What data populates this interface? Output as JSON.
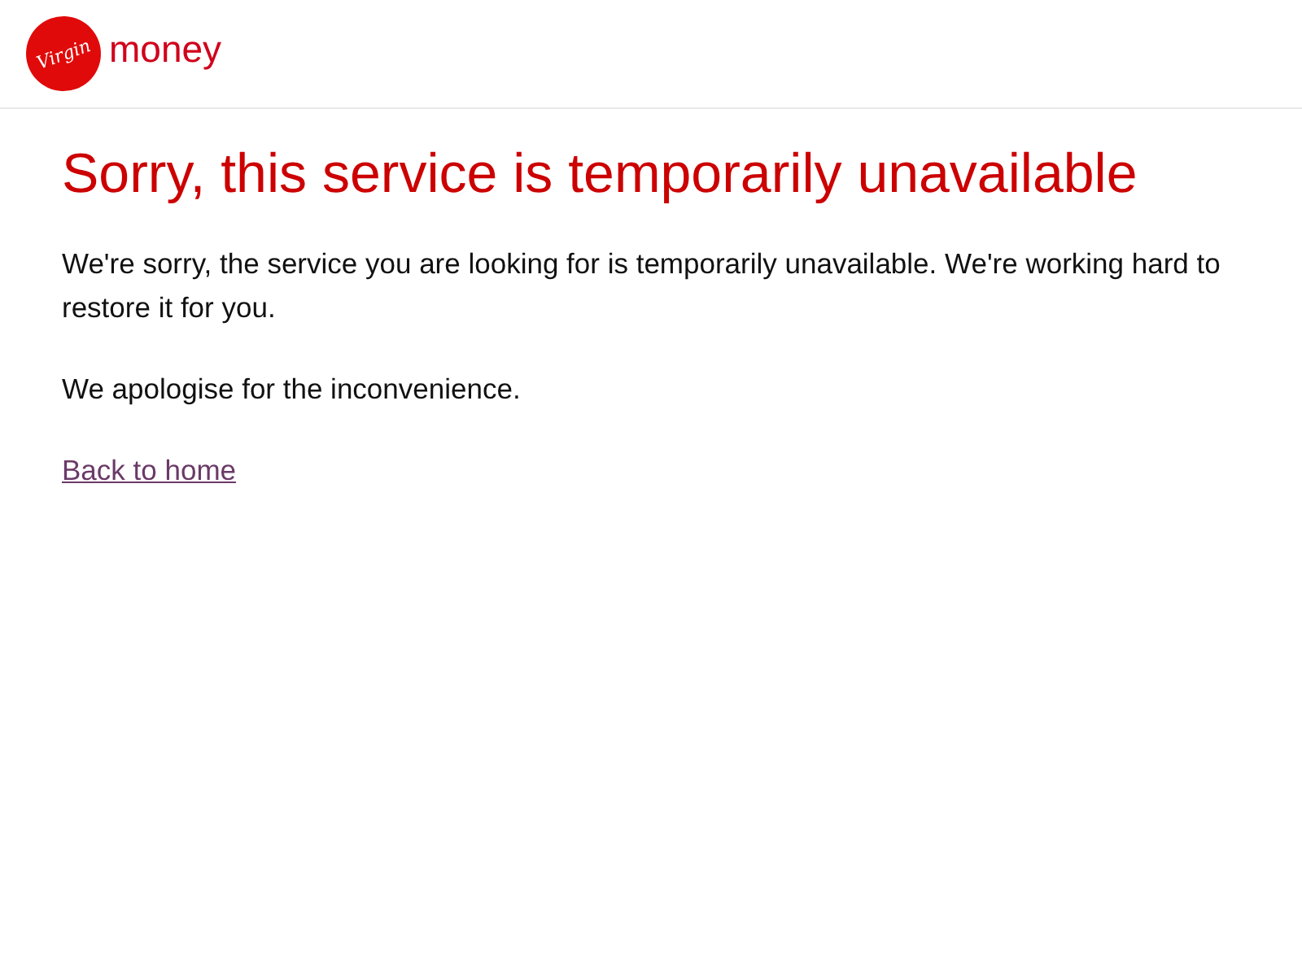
{
  "header": {
    "logo": {
      "mark": "Virgin",
      "word": "money"
    }
  },
  "content": {
    "title": "Sorry, this service is temporarily unavailable",
    "paragraphs": [
      "We're sorry, the service you are looking for is temporarily unavailable. We're working hard to restore it for you.",
      "We apologise for the inconvenience."
    ],
    "link": "Back to home"
  }
}
